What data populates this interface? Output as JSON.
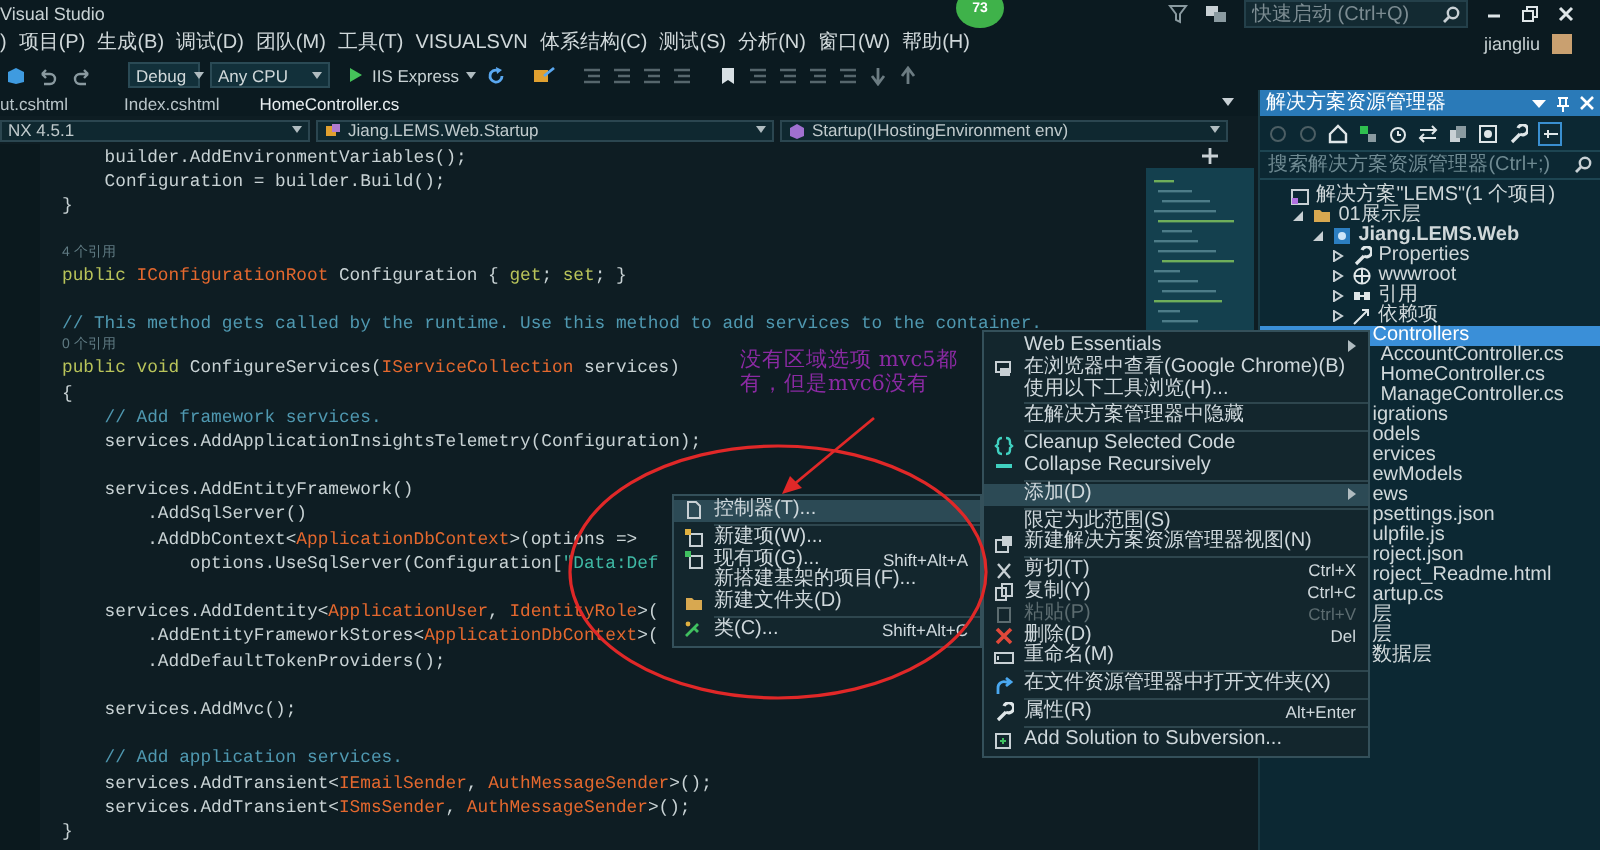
{
  "window": {
    "title": "Visual Studio",
    "badge": "73",
    "quick_launch": {
      "placeholder": "快速启动 (Ctrl+Q)"
    },
    "user": "jiangliu"
  },
  "menu": [
    ")",
    "项目(P)",
    "生成(B)",
    "调试(D)",
    "团队(M)",
    "工具(T)",
    "VISUALSVN",
    "体系结构(C)",
    "测试(S)",
    "分析(N)",
    "窗口(W)",
    "帮助(H)"
  ],
  "toolbar": {
    "configuration": "Debug",
    "platform": "Any CPU",
    "run": "IIS Express"
  },
  "tabs": [
    {
      "label": "ut.cshtml",
      "selected": false
    },
    {
      "label": "Index.cshtml",
      "selected": false
    },
    {
      "label": "HomeController.cs",
      "selected": true
    }
  ],
  "nav": [
    "NX 4.5.1",
    "Jiang.LEMS.Web.Startup",
    "Startup(IHostingEnvironment env)"
  ],
  "code": [
    {
      "kind": "code",
      "tokens": [
        {
          "text": "    builder.AddEnvironmentVariables();",
          "kind": "plain"
        }
      ]
    },
    {
      "kind": "code",
      "tokens": [
        {
          "text": "    Configuration = builder.Build();",
          "kind": "plain"
        }
      ]
    },
    {
      "kind": "code",
      "tokens": [
        {
          "text": "}",
          "kind": "plain"
        }
      ]
    },
    {
      "kind": "blank"
    },
    {
      "kind": "lens",
      "text": "4 个引用"
    },
    {
      "kind": "code",
      "tokens": [
        {
          "text": "public ",
          "kind": "keyword"
        },
        {
          "text": "IConfigurationRoot",
          "kind": "type"
        },
        {
          "text": " Configuration { ",
          "kind": "plain"
        },
        {
          "text": "get",
          "kind": "keyword"
        },
        {
          "text": "; ",
          "kind": "plain"
        },
        {
          "text": "set",
          "kind": "keyword"
        },
        {
          "text": "; }",
          "kind": "plain"
        }
      ]
    },
    {
      "kind": "blank"
    },
    {
      "kind": "code",
      "tokens": [
        {
          "text": "// This method gets called by the runtime. Use this method to add services to the container.",
          "kind": "comment"
        }
      ]
    },
    {
      "kind": "lens",
      "text": "0 个引用"
    },
    {
      "kind": "code",
      "tokens": [
        {
          "text": "public void",
          "kind": "keyword"
        },
        {
          "text": " ConfigureServices(",
          "kind": "plain"
        },
        {
          "text": "IServiceCollection",
          "kind": "type"
        },
        {
          "text": " services)",
          "kind": "plain"
        }
      ]
    },
    {
      "kind": "code",
      "tokens": [
        {
          "text": "{",
          "kind": "plain"
        }
      ]
    },
    {
      "kind": "code",
      "tokens": [
        {
          "text": "    // Add framework services.",
          "kind": "comment"
        }
      ]
    },
    {
      "kind": "code",
      "tokens": [
        {
          "text": "    services.AddApplicationInsightsTelemetry(Configuration);",
          "kind": "plain"
        }
      ]
    },
    {
      "kind": "blank"
    },
    {
      "kind": "code",
      "tokens": [
        {
          "text": "    services.AddEntityFramework()",
          "kind": "plain"
        }
      ]
    },
    {
      "kind": "code",
      "tokens": [
        {
          "text": "        .AddSqlServer()",
          "kind": "plain"
        }
      ]
    },
    {
      "kind": "code",
      "tokens": [
        {
          "text": "        .AddDbContext<",
          "kind": "plain"
        },
        {
          "text": "ApplicationDbContext",
          "kind": "type"
        },
        {
          "text": ">(options =>",
          "kind": "plain"
        }
      ]
    },
    {
      "kind": "code",
      "tokens": [
        {
          "text": "            options.UseSqlServer(Configuration[",
          "kind": "plain"
        },
        {
          "text": "\"Data:Def",
          "kind": "string"
        }
      ]
    },
    {
      "kind": "blank"
    },
    {
      "kind": "code",
      "tokens": [
        {
          "text": "    services.AddIdentity<",
          "kind": "plain"
        },
        {
          "text": "ApplicationUser",
          "kind": "type"
        },
        {
          "text": ", ",
          "kind": "plain"
        },
        {
          "text": "IdentityRole",
          "kind": "type"
        },
        {
          "text": ">(",
          "kind": "plain"
        }
      ]
    },
    {
      "kind": "code",
      "tokens": [
        {
          "text": "        .AddEntityFrameworkStores<",
          "kind": "plain"
        },
        {
          "text": "ApplicationDbContext",
          "kind": "type"
        },
        {
          "text": ">(",
          "kind": "plain"
        }
      ]
    },
    {
      "kind": "code",
      "tokens": [
        {
          "text": "        .AddDefaultTokenProviders();",
          "kind": "plain"
        }
      ]
    },
    {
      "kind": "blank"
    },
    {
      "kind": "code",
      "tokens": [
        {
          "text": "    services.AddMvc();",
          "kind": "plain"
        }
      ]
    },
    {
      "kind": "blank"
    },
    {
      "kind": "code",
      "tokens": [
        {
          "text": "    // Add application services.",
          "kind": "comment"
        }
      ]
    },
    {
      "kind": "code",
      "tokens": [
        {
          "text": "    services.AddTransient<",
          "kind": "plain"
        },
        {
          "text": "IEmailSender",
          "kind": "type"
        },
        {
          "text": ", ",
          "kind": "plain"
        },
        {
          "text": "AuthMessageSender",
          "kind": "type"
        },
        {
          "text": ">();",
          "kind": "plain"
        }
      ]
    },
    {
      "kind": "code",
      "tokens": [
        {
          "text": "    services.AddTransient<",
          "kind": "plain"
        },
        {
          "text": "ISmsSender",
          "kind": "type"
        },
        {
          "text": ", ",
          "kind": "plain"
        },
        {
          "text": "AuthMessageSender",
          "kind": "type"
        },
        {
          "text": ">();",
          "kind": "plain"
        }
      ]
    },
    {
      "kind": "code",
      "tokens": [
        {
          "text": "}",
          "kind": "plain"
        }
      ]
    }
  ],
  "annotation": {
    "text": "没有区域选项 mvc5都有，但是mvc6没有"
  },
  "context_menu": {
    "items": [
      {
        "kind": "item",
        "label": "Web Essentials",
        "submenu": true,
        "selected": false,
        "disabled": false
      },
      {
        "kind": "item",
        "label": "在浏览器中查看(Google Chrome)(B)",
        "submenu": false,
        "selected": false,
        "disabled": false
      },
      {
        "kind": "item",
        "label": "使用以下工具浏览(H)...",
        "submenu": false,
        "selected": false,
        "disabled": false
      },
      {
        "kind": "separator"
      },
      {
        "kind": "item",
        "label": "在解决方案管理器中隐藏",
        "submenu": false,
        "selected": false,
        "disabled": false
      },
      {
        "kind": "separator"
      },
      {
        "kind": "item",
        "label": "Cleanup Selected Code",
        "submenu": false,
        "selected": false,
        "disabled": false
      },
      {
        "kind": "item",
        "label": "Collapse Recursively",
        "submenu": false,
        "selected": false,
        "disabled": false
      },
      {
        "kind": "separator"
      },
      {
        "kind": "item",
        "label": "添加(D)",
        "submenu": true,
        "selected": true,
        "disabled": false
      },
      {
        "kind": "separator"
      },
      {
        "kind": "item",
        "label": "限定为此范围(S)",
        "submenu": false,
        "selected": false,
        "disabled": false
      },
      {
        "kind": "item",
        "label": "新建解决方案资源管理器视图(N)",
        "submenu": false,
        "selected": false,
        "disabled": false
      },
      {
        "kind": "separator"
      },
      {
        "kind": "item",
        "label": "剪切(T)",
        "shortcut": "Ctrl+X",
        "submenu": false,
        "selected": false,
        "disabled": false
      },
      {
        "kind": "item",
        "label": "复制(Y)",
        "shortcut": "Ctrl+C",
        "submenu": false,
        "selected": false,
        "disabled": false
      },
      {
        "kind": "item",
        "label": "粘贴(P)",
        "shortcut": "Ctrl+V",
        "submenu": false,
        "selected": false,
        "disabled": true
      },
      {
        "kind": "item",
        "label": "删除(D)",
        "shortcut": "Del",
        "submenu": false,
        "selected": false,
        "disabled": false
      },
      {
        "kind": "item",
        "label": "重命名(M)",
        "submenu": false,
        "selected": false,
        "disabled": false
      },
      {
        "kind": "separator"
      },
      {
        "kind": "item",
        "label": "在文件资源管理器中打开文件夹(X)",
        "submenu": false,
        "selected": false,
        "disabled": false
      },
      {
        "kind": "separator"
      },
      {
        "kind": "item",
        "label": "属性(R)",
        "shortcut": "Alt+Enter",
        "submenu": false,
        "selected": false,
        "disabled": false
      },
      {
        "kind": "separator"
      },
      {
        "kind": "item",
        "label": "Add Solution to Subversion...",
        "submenu": false,
        "selected": false,
        "disabled": false
      }
    ]
  },
  "add_submenu": {
    "items": [
      {
        "kind": "item",
        "label": "控制器(T)...",
        "selected": true
      },
      {
        "kind": "separator"
      },
      {
        "kind": "item",
        "label": "新建项(W)...",
        "selected": false
      },
      {
        "kind": "item",
        "label": "现有项(G)...",
        "shortcut": "Shift+Alt+A",
        "selected": false
      },
      {
        "kind": "item",
        "label": "新搭建基架的项目(F)...",
        "selected": false
      },
      {
        "kind": "item",
        "label": "新建文件夹(D)",
        "selected": false
      },
      {
        "kind": "separator"
      },
      {
        "kind": "item",
        "label": "类(C)...",
        "shortcut": "Shift+Alt+C",
        "selected": false
      }
    ]
  },
  "solution_explorer": {
    "title": "解决方案资源管理器",
    "search": {
      "placeholder": "搜索解决方案资源管理器(Ctrl+;)"
    },
    "tree": [
      {
        "label": "解决方案\"LEMS\"(1 个项目)",
        "kind": "solution",
        "selected": false,
        "children": [
          {
            "label": "01展示层",
            "kind": "folder",
            "expanded": true,
            "selected": false,
            "children": [
              {
                "label": "Jiang.LEMS.Web",
                "kind": "project",
                "expanded": true,
                "selected": false,
                "children": [
                  {
                    "label": "Properties",
                    "kind": "properties",
                    "expanded": false,
                    "selected": false
                  },
                  {
                    "label": "wwwroot",
                    "kind": "web",
                    "expanded": false,
                    "selected": false
                  },
                  {
                    "label": "引用",
                    "kind": "references",
                    "expanded": false,
                    "selected": false
                  },
                  {
                    "label": "依赖项",
                    "kind": "dependencies",
                    "expanded": false,
                    "selected": false
                  },
                  {
                    "label": "Controllers",
                    "selected": true,
                    "children": [
                      {
                        "label": "AccountController.cs",
                        "selected": false
                      },
                      {
                        "label": "HomeController.cs",
                        "selected": false
                      },
                      {
                        "label": "ManageController.cs",
                        "selected": false
                      }
                    ]
                  },
                  {
                    "label": "igrations",
                    "selected": false
                  },
                  {
                    "label": "odels",
                    "selected": false
                  },
                  {
                    "label": "ervices",
                    "selected": false
                  },
                  {
                    "label": "ewModels",
                    "selected": false
                  },
                  {
                    "label": "ews",
                    "selected": false
                  },
                  {
                    "label": "psettings.json",
                    "selected": false
                  },
                  {
                    "label": "ulpfile.js",
                    "selected": false
                  },
                  {
                    "label": "roject.json",
                    "selected": false
                  },
                  {
                    "label": "roject_Readme.html",
                    "selected": false
                  },
                  {
                    "label": "artup.cs",
                    "selected": false
                  }
                ]
              }
            ]
          },
          {
            "label": "层",
            "selected": false
          },
          {
            "label": "层",
            "selected": false
          },
          {
            "label": "数据层",
            "selected": false
          }
        ]
      }
    ]
  }
}
